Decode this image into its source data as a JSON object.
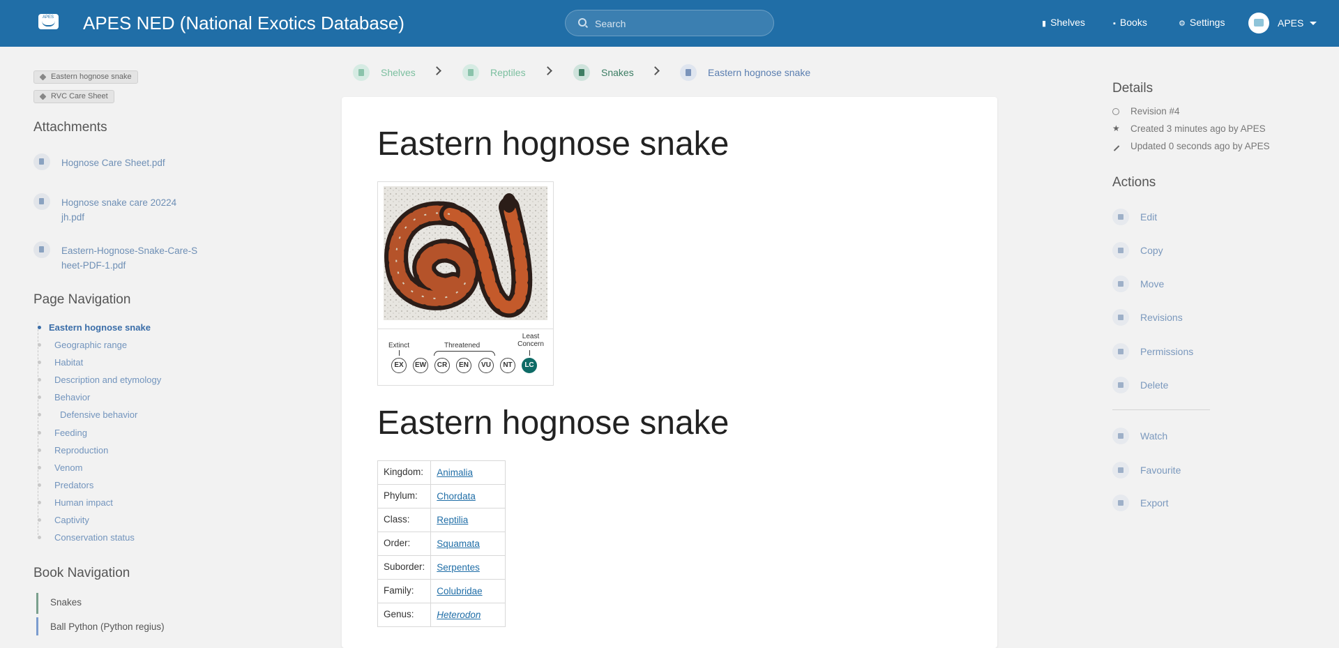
{
  "header": {
    "app_title": "APES NED (National Exotics Database)",
    "logo_text": "APES",
    "search_placeholder": "Search",
    "nav": {
      "shelves": "Shelves",
      "books": "Books",
      "settings": "Settings"
    },
    "user_name": "APES",
    "brand_color": "#206ea7"
  },
  "tags": [
    "Eastern hognose snake",
    "RVC Care Sheet"
  ],
  "attachments": {
    "heading": "Attachments",
    "files": [
      "Hognose Care Sheet.pdf",
      "Hognose snake care 20224 jh.pdf",
      "Eastern-Hognose-Snake-Care-Sheet-PDF-1.pdf"
    ]
  },
  "page_navigation": {
    "heading": "Page Navigation",
    "items": [
      "Eastern hognose snake",
      "Geographic range",
      "Habitat",
      "Description and etymology",
      "Behavior",
      "Defensive behavior",
      "Feeding",
      "Reproduction",
      "Venom",
      "Predators",
      "Human impact",
      "Captivity",
      "Conservation status"
    ]
  },
  "book_navigation": {
    "heading": "Book Navigation",
    "items": [
      "Snakes",
      "Ball Python (Python regius)"
    ]
  },
  "breadcrumbs": [
    "Shelves",
    "Reptiles",
    "Snakes",
    "Eastern hognose snake"
  ],
  "content": {
    "title": "Eastern hognose snake",
    "subtitle": "Eastern hognose snake",
    "conservation": {
      "labels": {
        "extinct": "Extinct",
        "threatened": "Threatened",
        "least_concern": "Least Concern"
      },
      "categories": [
        "EX",
        "EW",
        "CR",
        "EN",
        "VU",
        "NT",
        "LC"
      ],
      "selected": "LC"
    },
    "taxonomy": [
      {
        "rank": "Kingdom:",
        "value": "Animalia"
      },
      {
        "rank": "Phylum:",
        "value": "Chordata"
      },
      {
        "rank": "Class:",
        "value": "Reptilia"
      },
      {
        "rank": "Order:",
        "value": "Squamata"
      },
      {
        "rank": "Suborder:",
        "value": "Serpentes"
      },
      {
        "rank": "Family:",
        "value": "Colubridae"
      },
      {
        "rank": "Genus:",
        "value": "Heterodon"
      }
    ]
  },
  "details": {
    "heading": "Details",
    "revision": "Revision #4",
    "created": "Created 3 minutes ago by APES",
    "updated": "Updated 0 seconds ago by APES"
  },
  "actions": {
    "heading": "Actions",
    "items": [
      "Edit",
      "Copy",
      "Move",
      "Revisions",
      "Permissions",
      "Delete",
      "Watch",
      "Favourite",
      "Export"
    ]
  }
}
